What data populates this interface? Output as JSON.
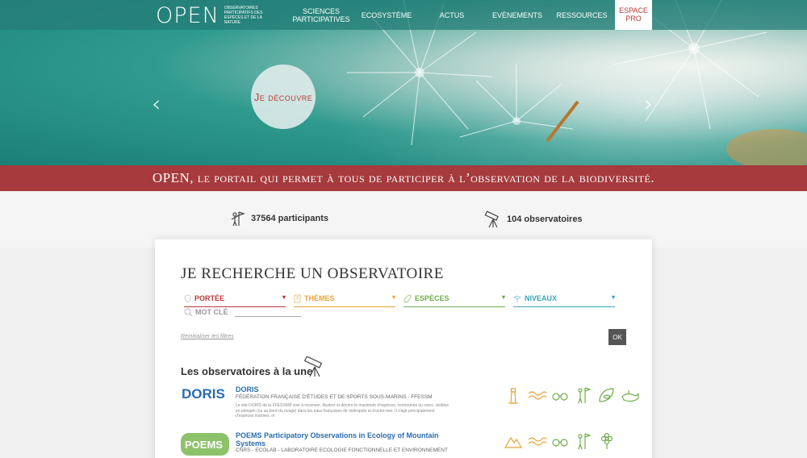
{
  "header": {
    "logo_word": "OPEN",
    "logo_sub": "Observatoires participatifs des espèces et de la nature",
    "nav": [
      {
        "label": "Sciences participatives"
      },
      {
        "label": "Ecosystème"
      },
      {
        "label": "Actus"
      },
      {
        "label": "Evènements"
      },
      {
        "label": "Ressources"
      }
    ],
    "pro": "Espace pro"
  },
  "hero": {
    "cta": "Je découvre",
    "prev_arrow": "‹",
    "next_arrow": "›"
  },
  "banner": "OPEN, le portail qui permet à tous de participer à l’observation de la biodiversité.",
  "stats": {
    "participants": "37564 participants",
    "observatoires": "104 observatoires"
  },
  "search": {
    "title": "Je recherche un observatoire",
    "filters": [
      {
        "label": "Portée",
        "color": "#b83a3a"
      },
      {
        "label": "Thèmes",
        "color": "#e8a33a"
      },
      {
        "label": "Espèces",
        "color": "#6fae4a"
      },
      {
        "label": "Niveaux",
        "color": "#3aa6b9"
      }
    ],
    "keyword_label": "Mot clé",
    "keyword_value": "",
    "reset": "Réinitialiser les filtres",
    "ok": "OK"
  },
  "featured": {
    "title": "Les observatoires à la une",
    "items": [
      {
        "logo": "DORIS",
        "name": "DORIS",
        "org": "Fédération française d'études et de sports sous-marins - FFESSM",
        "desc": "Le site DORIS de la FFESSM® vise à recenser, illustrer et décrire le maximum d'espèces, communes ou rares, visibles en plongée (ou au bord du rivage) dans les eaux françaises de métropole et d'outre-mer. Il s'agit principalement d'espèces marines, m",
        "icons": [
          "lighthouse-icon",
          "wave-icon",
          "binoculars-icon",
          "flag-person-icon",
          "leaf-fish-icon",
          "whale-icon"
        ]
      },
      {
        "logo": "POEMS",
        "name": "POEMS Participatory Observations in Ecology of Mountain Systems",
        "org": "CNRS - ECOLAB - Laboratoire Ecologie fonctionnelle et environnement",
        "desc": "",
        "icons": [
          "mountain-icon",
          "wave-icon",
          "binoculars-icon",
          "flag-person-icon",
          "flower-icon"
        ]
      }
    ]
  },
  "colors": {
    "teal": "#247c76",
    "banner_red": "#a63a3c",
    "accent_red": "#b83a3a",
    "link_blue": "#2a6db0",
    "icon_orange": "#e8a33a",
    "icon_green": "#6fae4a"
  }
}
